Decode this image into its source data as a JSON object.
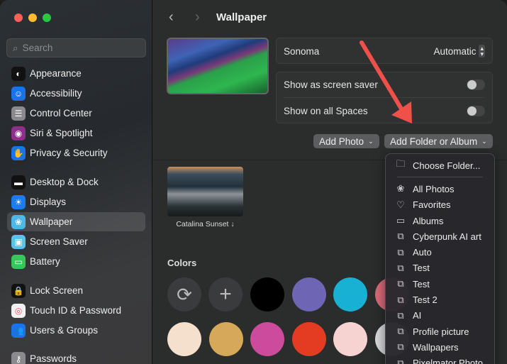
{
  "sidebar": {
    "search_placeholder": "Search",
    "items": [
      {
        "label": "Appearance",
        "icon": "appearance-icon",
        "color": "#111"
      },
      {
        "label": "Accessibility",
        "icon": "accessibility-icon",
        "color": "#1a73e8"
      },
      {
        "label": "Control Center",
        "icon": "control-center-icon",
        "color": "#8a8a8e"
      },
      {
        "label": "Siri & Spotlight",
        "icon": "siri-icon",
        "color": "#8e2f8a"
      },
      {
        "label": "Privacy & Security",
        "icon": "hand-icon",
        "color": "#1a73e8"
      },
      {
        "label": "Desktop & Dock",
        "icon": "dock-icon",
        "color": "#111"
      },
      {
        "label": "Displays",
        "icon": "sun-icon",
        "color": "#1a7cf0"
      },
      {
        "label": "Wallpaper",
        "icon": "flower-icon",
        "color": "#4fb6e8"
      },
      {
        "label": "Screen Saver",
        "icon": "screen-saver-icon",
        "color": "#5ac1e8"
      },
      {
        "label": "Battery",
        "icon": "battery-icon",
        "color": "#34c759"
      },
      {
        "label": "Lock Screen",
        "icon": "lock-icon",
        "color": "#111"
      },
      {
        "label": "Touch ID & Password",
        "icon": "fingerprint-icon",
        "color": "#f2f2f2"
      },
      {
        "label": "Users & Groups",
        "icon": "users-icon",
        "color": "#1a73e8"
      },
      {
        "label": "Passwords",
        "icon": "key-icon",
        "color": "#8a8a8e"
      }
    ]
  },
  "header": {
    "title": "Wallpaper"
  },
  "wallpaper": {
    "name": "Sonoma",
    "mode": "Automatic",
    "screen_saver_label": "Show as screen saver",
    "screen_saver_on": false,
    "all_spaces_label": "Show on all Spaces",
    "all_spaces_on": false
  },
  "buttons": {
    "add_photo": "Add Photo",
    "add_folder": "Add Folder or Album"
  },
  "gallery": {
    "item_label": "Catalina Sunset ↓"
  },
  "colors": {
    "heading": "Colors",
    "row1": [
      "#000000",
      "#6e66b5",
      "#18b0d3",
      "#d86a78"
    ],
    "row2": [
      "#f4e0cc",
      "#d6a85a",
      "#cd4b9c",
      "#e43c22",
      "#f6d3d0",
      "#d8d8da"
    ]
  },
  "menu": {
    "choose_folder": "Choose Folder...",
    "items": [
      {
        "label": "All Photos",
        "icon": "❀"
      },
      {
        "label": "Favorites",
        "icon": "♡"
      },
      {
        "label": "Albums",
        "icon": "▭"
      },
      {
        "label": "Cyberpunk AI art",
        "icon": "⧉"
      },
      {
        "label": "Auto",
        "icon": "⧉"
      },
      {
        "label": "Test",
        "icon": "⧉"
      },
      {
        "label": "Test",
        "icon": "⧉"
      },
      {
        "label": "Test 2",
        "icon": "⧉"
      },
      {
        "label": "AI",
        "icon": "⧉"
      },
      {
        "label": "Profile picture",
        "icon": "⧉"
      },
      {
        "label": "Wallpapers",
        "icon": "⧉"
      },
      {
        "label": "Pixelmator Photo",
        "icon": "⧉"
      }
    ]
  }
}
